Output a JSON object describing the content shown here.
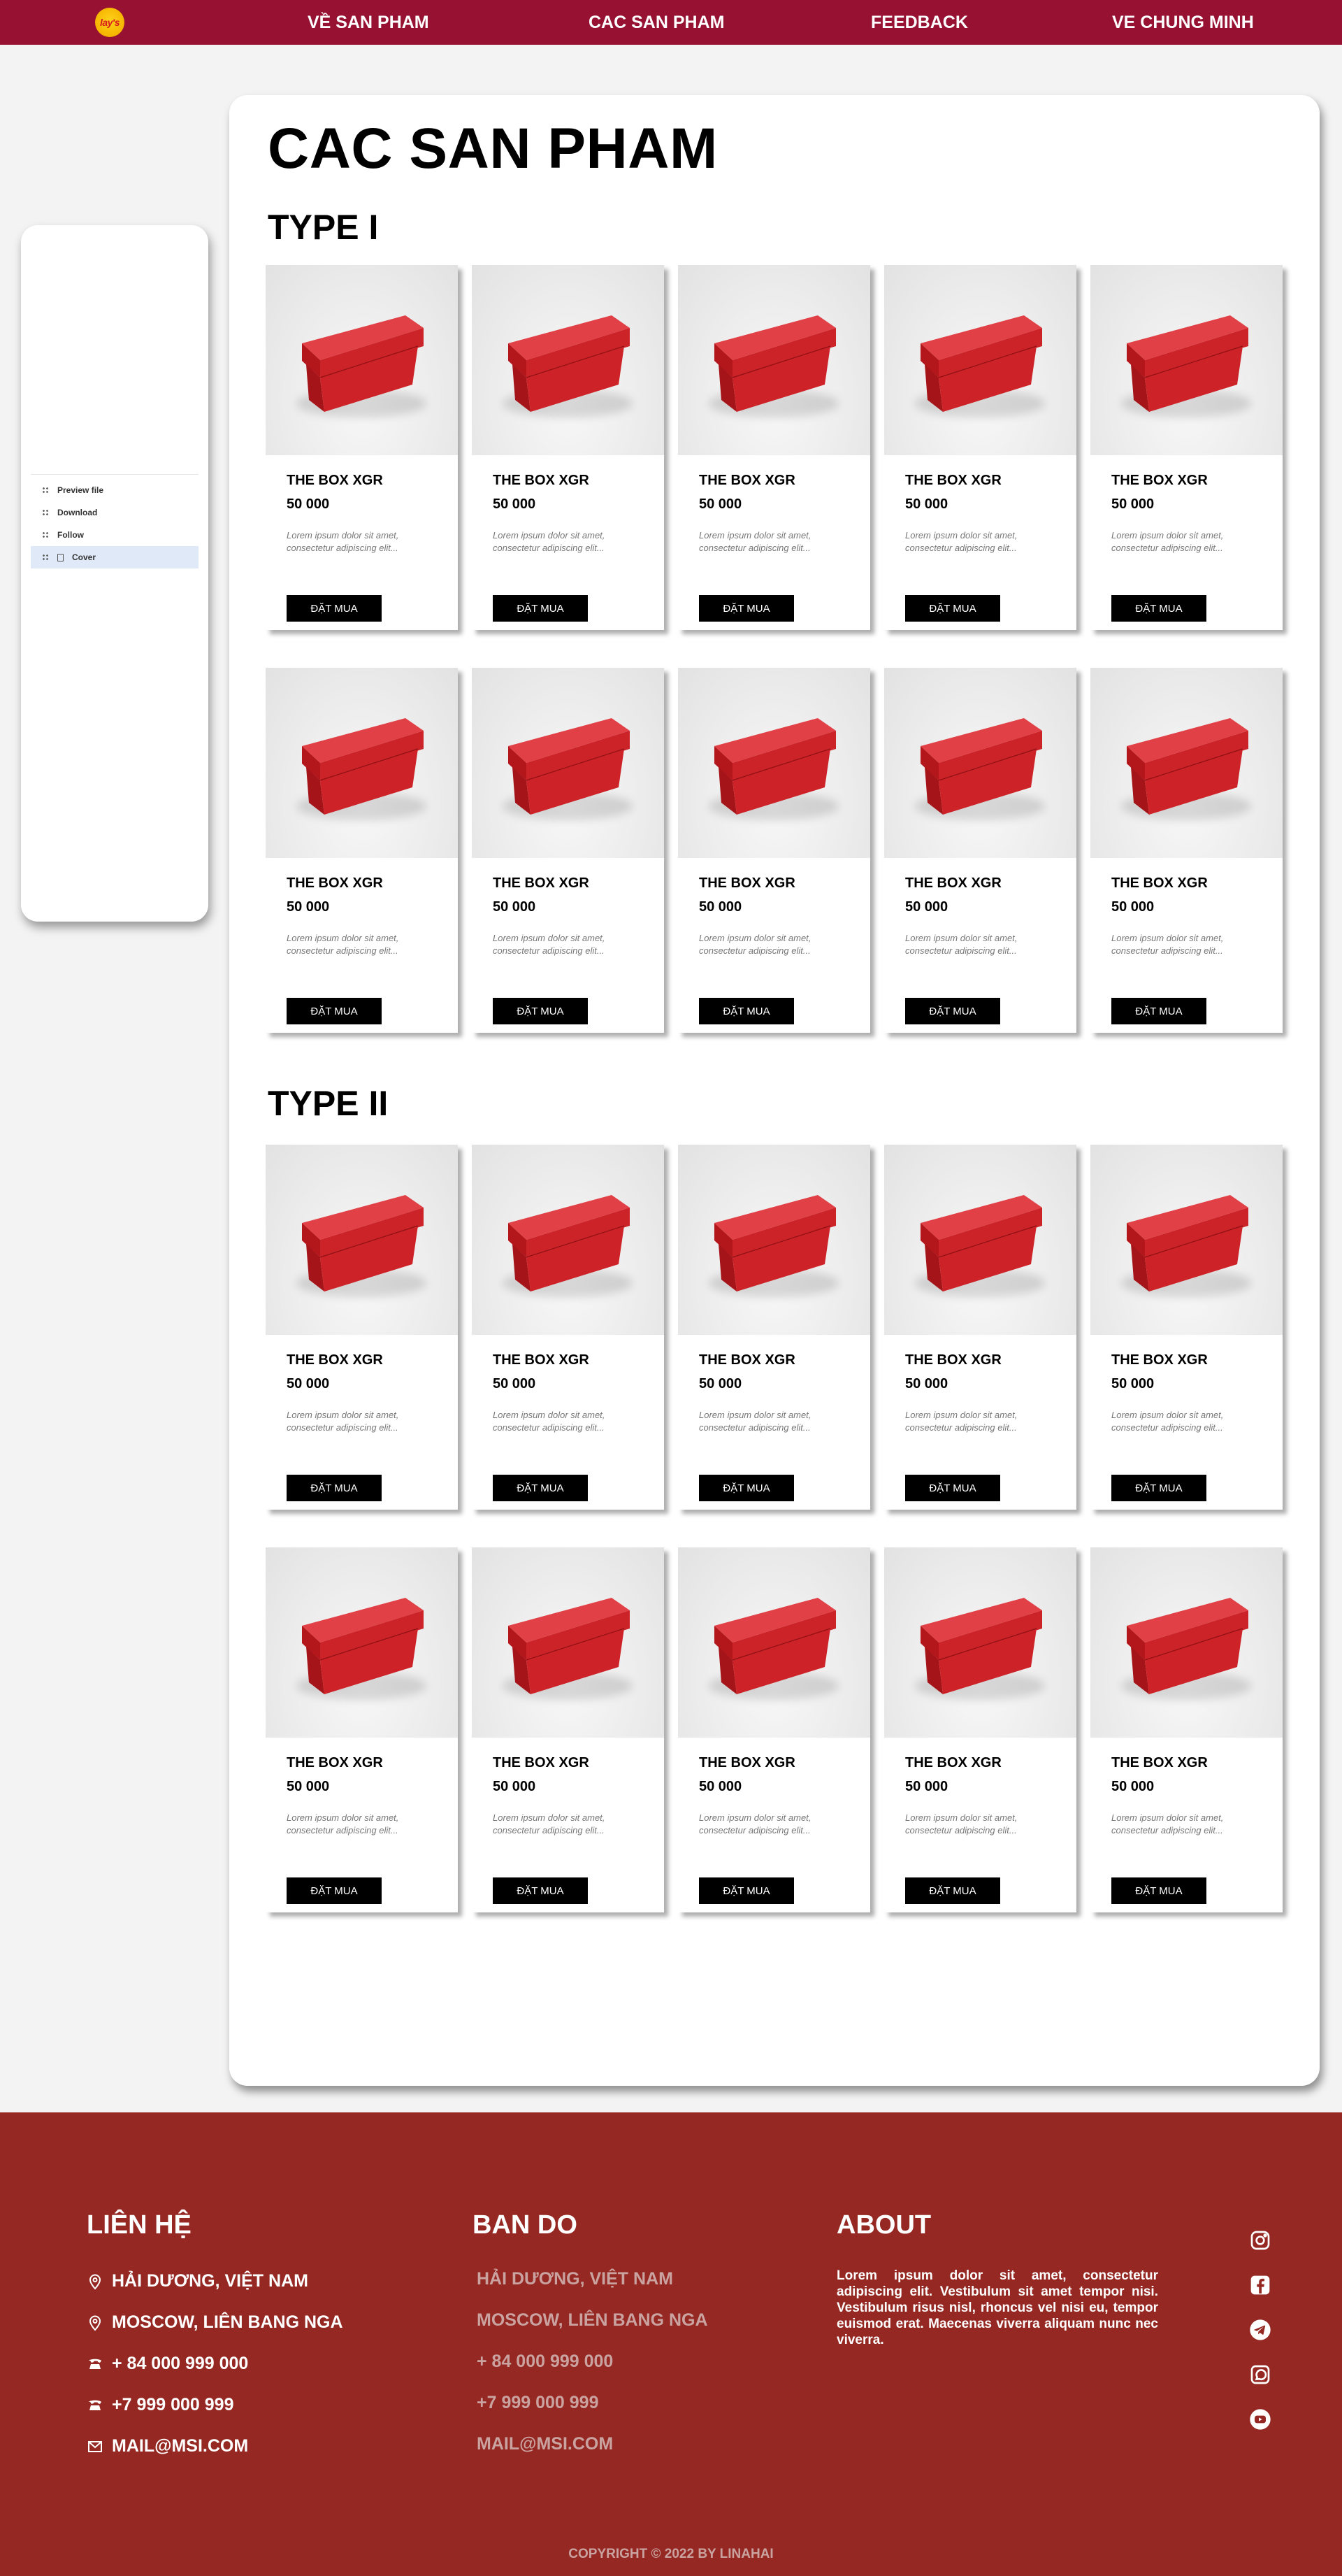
{
  "brand": {
    "logo_text": "lay's"
  },
  "nav": [
    "VỀ SAN PHAM",
    "CAC SAN PHAM",
    "FEEDBACK",
    "VE CHUNG MINH"
  ],
  "sidebar": {
    "items": [
      {
        "label": "Preview file",
        "icon": "grip-icon"
      },
      {
        "label": "Download",
        "icon": "grip-icon"
      },
      {
        "label": "Follow",
        "icon": "grip-icon"
      },
      {
        "label": "Cover",
        "icon": "page-icon",
        "active": true
      }
    ]
  },
  "main": {
    "title": "CAC SAN PHAM",
    "sections": [
      {
        "title": "TYPE I"
      },
      {
        "title": "TYPE II"
      }
    ],
    "product": {
      "name": "THE BOX XGR",
      "price": "50 000",
      "description": "Lorem ipsum dolor sit amet, consectetur adipiscing elit...",
      "button": "ĐẶT MUA"
    }
  },
  "footer": {
    "contact": {
      "title": "LIÊN HỆ",
      "items": [
        {
          "icon": "location-pin-icon",
          "text": "HẢI DƯƠNG, VIỆT NAM"
        },
        {
          "icon": "location-pin-icon",
          "text": "MOSCOW, LIÊN BANG NGA"
        },
        {
          "icon": "phone-icon",
          "text": "+ 84 000 999 000"
        },
        {
          "icon": "phone-icon",
          "text": "+7 999 000 999"
        },
        {
          "icon": "mail-icon",
          "text": "MAIL@MSI.COM"
        }
      ]
    },
    "map": {
      "title": "BAN DO",
      "items": [
        "HẢI DƯƠNG, VIỆT NAM",
        "MOSCOW, LIÊN BANG NGA",
        "+ 84 000 999 000",
        "+7 999 000 999",
        "MAIL@MSI.COM"
      ]
    },
    "about": {
      "title": "ABOUT",
      "text": "Lorem ipsum dolor sit amet, consectetur adipiscing elit. Vestibulum sit amet tempor nisi. Vestibulum risus nisl, rhoncus vel nisi eu, tempor euismod erat. Maecenas viverra aliquam nunc nec viverra."
    },
    "socials": [
      "instagram-icon",
      "facebook-icon",
      "telegram-icon",
      "whatsapp-icon",
      "youtube-icon"
    ],
    "copyright": "COPYRIGHT © 2022 BY LINAHAI"
  },
  "colors": {
    "navbar": "#961132",
    "footer": "#952822",
    "button": "#000000",
    "box_red": "#d3262b"
  }
}
